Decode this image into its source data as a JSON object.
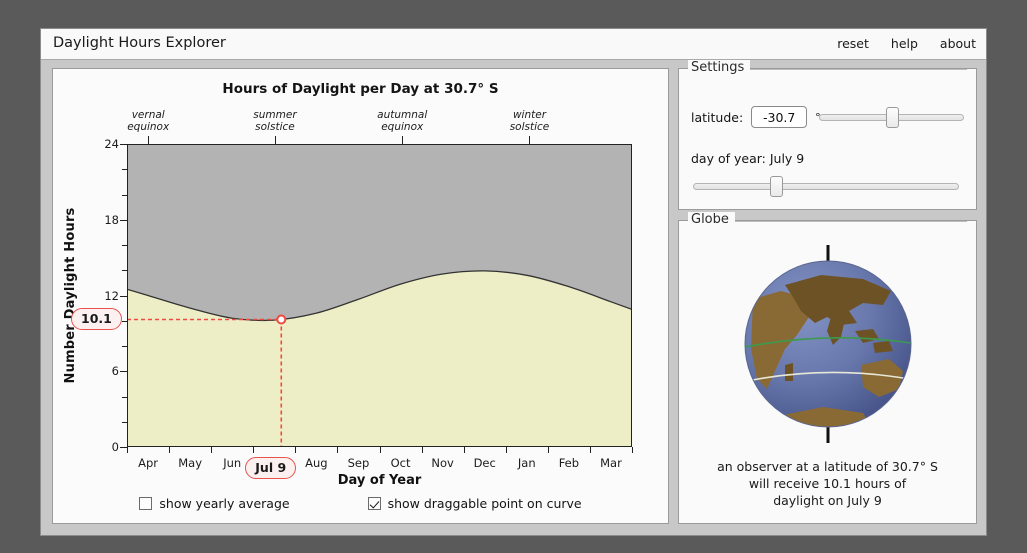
{
  "window": {
    "title": "Daylight Hours Explorer",
    "menu": [
      {
        "label": "reset"
      },
      {
        "label": "help"
      },
      {
        "label": "about"
      }
    ]
  },
  "chart_data": {
    "type": "area",
    "title": "Hours of Daylight per Day at 30.7° S",
    "xlabel": "Day of Year",
    "ylabel": "Number Daylight Hours",
    "ylim": [
      0,
      24
    ],
    "yticks": [
      0,
      6,
      12,
      18,
      24
    ],
    "ytick_labels": [
      "0",
      "6",
      "12",
      "18",
      "24"
    ],
    "yminor_step": 2,
    "grid": false,
    "legend": "none",
    "categories": [
      "Apr",
      "May",
      "Jun",
      "Jul",
      "Aug",
      "Sep",
      "Oct",
      "Nov",
      "Dec",
      "Jan",
      "Feb",
      "Mar"
    ],
    "series": [
      {
        "name": "daylight hours",
        "values": [
          12.0,
          11.0,
          10.2,
          10.05,
          10.6,
          11.7,
          12.9,
          13.7,
          13.95,
          13.6,
          12.7,
          11.5
        ]
      }
    ],
    "fill_day_color": "#eeeec6",
    "fill_night_color": "#b3b3b3",
    "curve_color": "#333333",
    "annotations": [
      {
        "name": "vernal equinox",
        "line1": "vernal",
        "line2": "equinox",
        "x_frac": 0.042
      },
      {
        "name": "summer solstice",
        "line1": "summer",
        "line2": "solstice",
        "x_frac": 0.293
      },
      {
        "name": "autumnal equinox",
        "line1": "autumnal",
        "line2": "equinox",
        "x_frac": 0.545
      },
      {
        "name": "winter solstice",
        "line1": "winter",
        "line2": "solstice",
        "x_frac": 0.797
      }
    ],
    "marker": {
      "x_frac": 0.3055,
      "value_hours": 10.1,
      "value_label": "10.1",
      "date_label": "Jul 9",
      "color": "#f04a42"
    }
  },
  "chart_options": [
    {
      "label": "show yearly average",
      "checked": false
    },
    {
      "label": "show draggable point on curve",
      "checked": true
    }
  ],
  "settings": {
    "title": "Settings",
    "latitude_label": "latitude:",
    "latitude_value": "-30.7",
    "degree_symbol": "°",
    "latitude_slider_pos_pct": 51,
    "day_of_year_label": "day of year: July 9",
    "day_of_year_slider_pos_pct": 31.5
  },
  "globe": {
    "title": "Globe",
    "caption_line1": "an observer at a latitude of 30.7° S",
    "caption_line2": "will receive 10.1 hours of",
    "caption_line3": "daylight on July 9",
    "ocean_color": "#6878ac",
    "land_color": "#8a6a34",
    "lit_color": "#a98a4e",
    "equator_color": "#3c9a4e",
    "latitude_line_color": "#e8e8d8"
  }
}
